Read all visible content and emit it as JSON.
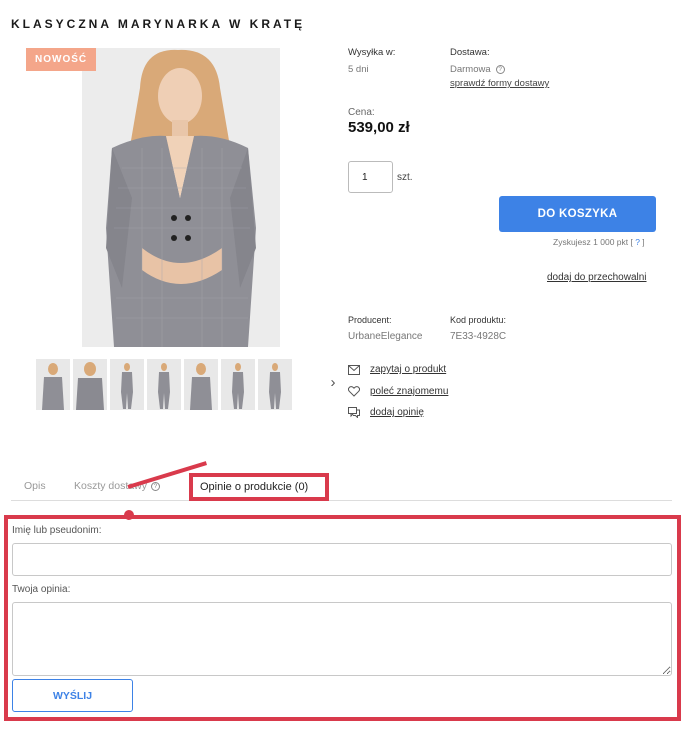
{
  "product": {
    "title": "KLASYCZNA MARYNARKA W KRATĘ",
    "badge": "NOWOŚĆ",
    "price_label": "Cena:",
    "price": "539,00 zł"
  },
  "shipping": {
    "label": "Wysyłka w:",
    "value": "5 dni"
  },
  "delivery": {
    "label": "Dostawa:",
    "value": "Darmowa",
    "link": "sprawdź formy dostawy"
  },
  "quantity": {
    "value": "1",
    "unit": "szt."
  },
  "cart": {
    "button": "DO KOSZYKA",
    "points_text": "Zyskujesz 1 000 pkt [",
    "points_help": " ? ",
    "points_end": "]"
  },
  "store_link": "dodaj do przechowalni",
  "producer": {
    "label": "Producent:",
    "value": "UrbaneElegance"
  },
  "code": {
    "label": "Kod produktu:",
    "value": "7E33-4928C"
  },
  "actions": [
    {
      "label": "zapytaj o produkt",
      "icon": "envelope-icon"
    },
    {
      "label": "poleć znajomemu",
      "icon": "heart-icon"
    },
    {
      "label": "dodaj opinię",
      "icon": "chat-icon"
    }
  ],
  "tabs": [
    {
      "label": "Opis"
    },
    {
      "label": "Koszty dostawy"
    },
    {
      "label": "Opinie o produkcie (0)"
    }
  ],
  "form": {
    "name_label": "Imię lub pseudonim:",
    "name_value": "",
    "opinion_label": "Twoja opinia:",
    "opinion_value": "",
    "submit": "WYŚLIJ"
  },
  "colors": {
    "accent": "#3d82e6",
    "badge": "#f4a68a",
    "highlight": "#d93a4c"
  }
}
